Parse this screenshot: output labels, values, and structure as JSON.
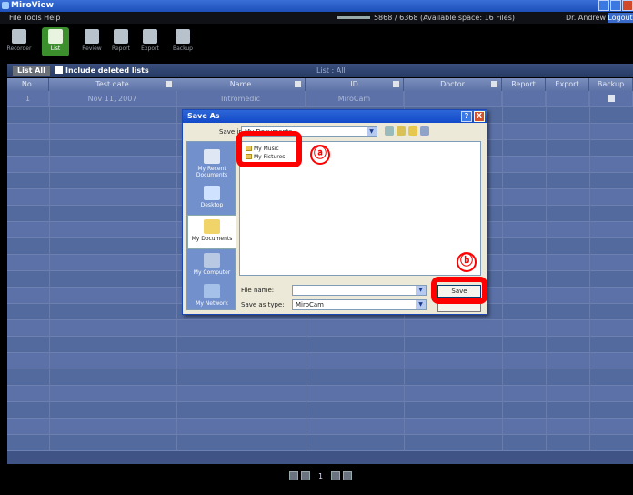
{
  "app": {
    "title": "MiroView"
  },
  "menubar": {
    "menu": "File Tools Help",
    "storage": "5868 / 6368 (Available space: 16 Files)",
    "doctor": "Dr. Andrew",
    "user_button": "Logout"
  },
  "toolbar": {
    "items": [
      {
        "label": "Recorder",
        "icon": "recorder-icon"
      },
      {
        "label": "List",
        "icon": "list-icon",
        "active": true
      },
      {
        "label": "Review",
        "icon": "review-icon"
      },
      {
        "label": "Report",
        "icon": "report-icon"
      },
      {
        "label": "Export",
        "icon": "export-icon"
      },
      {
        "label": "Backup",
        "icon": "backup-icon"
      }
    ]
  },
  "listbar": {
    "list_all": "List All",
    "include_deleted": "Include deleted lists",
    "title": "List : All"
  },
  "table": {
    "columns": [
      "No.",
      "Test date",
      "Name",
      "ID",
      "Doctor",
      "Report",
      "Export",
      "Backup"
    ],
    "rows": [
      {
        "no": "1",
        "date": "Nov 11, 2007",
        "name": "Intromedic",
        "id": "MiroCam"
      }
    ]
  },
  "pager": {
    "page": "1"
  },
  "dialog": {
    "title": "Save As",
    "help": "?",
    "close": "X",
    "save_in_label": "Save in:",
    "save_in_value": "My Documents",
    "places": [
      "My Recent Documents",
      "Desktop",
      "My Documents",
      "My Computer",
      "My Network"
    ],
    "files": [
      "My Music",
      "My Pictures"
    ],
    "file_name_label": "File name:",
    "file_name_value": "",
    "save_type_label": "Save as type:",
    "save_type_value": "MiroCam",
    "save_button": "Save",
    "cancel_button": ""
  },
  "annotations": {
    "a": "ⓐ",
    "b": "ⓑ"
  },
  "colors": {
    "highlight": "#ff0000",
    "titlebar": "#2c66d8",
    "table_bg": "#566da3",
    "active_tool": "#3b8f2c"
  }
}
